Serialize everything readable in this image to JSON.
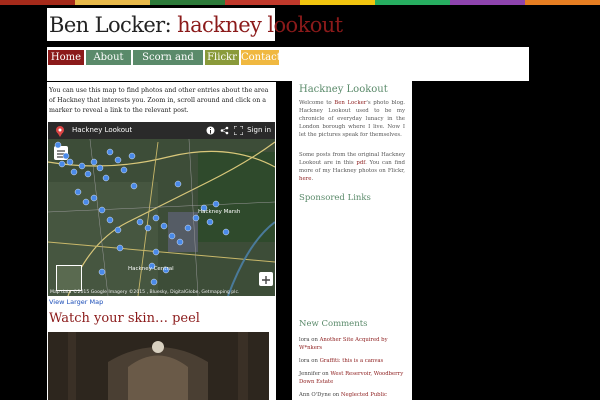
{
  "colors": {
    "accent": "#8b1a1a",
    "green": "#5a8a6a",
    "stripe": [
      "#a52a1a",
      "#e8b94a",
      "#2d7a3a",
      "#c0392b",
      "#f1c40f",
      "#27ae60",
      "#8e44ad",
      "#e67e22"
    ]
  },
  "header": {
    "name": "Ben Locker:",
    "blog": "hackney lookout"
  },
  "nav": [
    {
      "label": "Home",
      "color": "#8b1a1a"
    },
    {
      "label": "About Me",
      "color": "#5a8a6a"
    },
    {
      "label": "Scorn and Noise",
      "color": "#5a8a6a"
    },
    {
      "label": "Flickr",
      "color": "#8a9a3a"
    },
    {
      "label": "Contact",
      "color": "#f0b840"
    }
  ],
  "main": {
    "intro": "You can use this map to find photos and other entries about the area of Hackney that interests you. Zoom in, scroll around and click on a marker to reveal a link to the relevant post.",
    "map": {
      "title": "Hackney Lookout",
      "sign_in": "Sign in",
      "attribution": "Map data ©2015 Google Imagery ©2015 , Bluesky, DigitalGlobe, Getmapping plc.",
      "places": [
        "Hackney Marsh",
        "Hackney Central"
      ],
      "view_larger": "View Larger Map"
    },
    "post_title": "Watch your skin… peel"
  },
  "sidebar": {
    "title": "Hackney Lookout",
    "about_pre": "Welcome to",
    "about_link": "Ben Locker",
    "about_post": "'s photo blog. Hackney Lookout used to be my chronicle of everyday lunacy in the London borough where I live. Now I let the pictures speak for themselves.",
    "posts_pre": "Some posts from the original Hackney Lookout are in this",
    "posts_pdf": "pdf",
    "posts_mid": ". You can find more of my Hackney photos on Flickr,",
    "posts_here": "here",
    "sponsored": "Sponsored Links",
    "new_comments": "New Comments",
    "comments": [
      {
        "author": "lora",
        "on": "on",
        "post": "Another Site Acquired by W*nkers"
      },
      {
        "author": "lora",
        "on": "on",
        "post": "Graffiti: this is a canvas"
      },
      {
        "author": "Jennifer",
        "on": "on",
        "post": "West Reservoir, Woodberry Down Estate"
      },
      {
        "author": "Ann O'Dyne",
        "on": "on",
        "post": "Neglected Public"
      }
    ]
  }
}
